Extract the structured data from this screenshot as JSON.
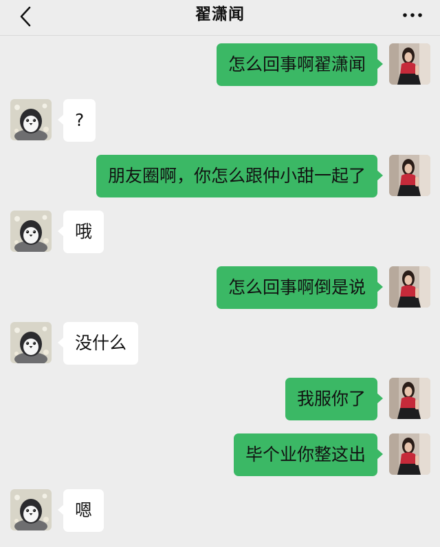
{
  "header": {
    "title": "翟潇闻",
    "back_icon": "chevron-left-icon",
    "more_icon": "more-dots-icon"
  },
  "colors": {
    "background": "#ededed",
    "outgoing_bubble": "#3bb865",
    "incoming_bubble": "#ffffff"
  },
  "messages": [
    {
      "direction": "outgoing",
      "text": "怎么回事啊翟潇闻",
      "avatar": "self-avatar"
    },
    {
      "direction": "incoming",
      "text": "?",
      "avatar": "penguin-avatar"
    },
    {
      "direction": "outgoing",
      "text": "朋友圈啊，你怎么跟仲小甜一起了",
      "avatar": "self-avatar"
    },
    {
      "direction": "incoming",
      "text": "哦",
      "avatar": "penguin-avatar"
    },
    {
      "direction": "outgoing",
      "text": "怎么回事啊倒是说",
      "avatar": "self-avatar"
    },
    {
      "direction": "incoming",
      "text": "没什么",
      "avatar": "penguin-avatar"
    },
    {
      "direction": "outgoing",
      "text": "我服你了",
      "avatar": "self-avatar"
    },
    {
      "direction": "outgoing",
      "text": "毕个业你整这出",
      "avatar": "self-avatar"
    },
    {
      "direction": "incoming",
      "text": "嗯",
      "avatar": "penguin-avatar"
    }
  ]
}
